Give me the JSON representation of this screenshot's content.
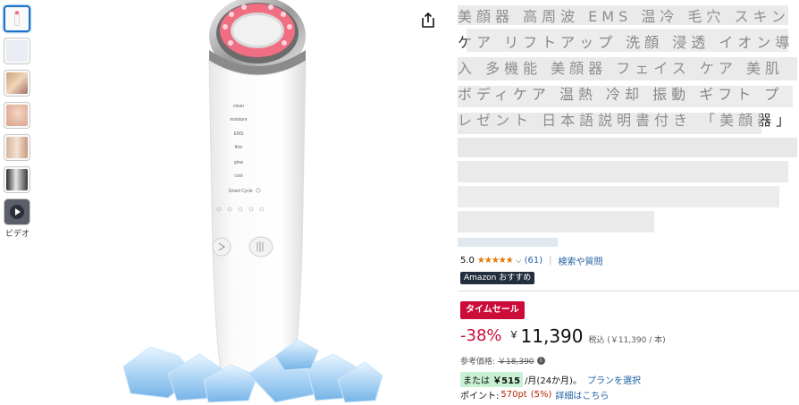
{
  "thumbnails": [
    {
      "name": "thumb-1",
      "active": true,
      "color": "#f2f2f2"
    },
    {
      "name": "thumb-2",
      "active": false,
      "color": "#e9edf3"
    },
    {
      "name": "thumb-3",
      "active": false,
      "color": "#c9a27b"
    },
    {
      "name": "thumb-4",
      "active": false,
      "color": "#e8c7b4"
    },
    {
      "name": "thumb-5",
      "active": false,
      "color": "#d7b59a"
    },
    {
      "name": "thumb-6",
      "active": false,
      "color": "#3b3b3b"
    }
  ],
  "video_label": "ビデオ",
  "device": {
    "labels": [
      "clean",
      "moisture",
      "EMS",
      "firm",
      "glow",
      "cool",
      "Smart Cycle"
    ],
    "accent": "#f06e82"
  },
  "title": {
    "text": "美顔器 高周波 EMS 温冷 毛穴 スキンケア リフトアップ 洗顔 浸透 イオン導入 多機能 美顔器 フェイス ケア 美肌 ボディケア 温熱 冷却 振動 ギフト プレゼント 日本語説明書付き 「美顔器」"
  },
  "rating": {
    "value": "5.0",
    "stars": "★★★★★",
    "count": "(61)",
    "qa": "検索や質問"
  },
  "amazon_badge": "Amazon おすすめ",
  "deal_label": "タイムセール",
  "price": {
    "discount": "-38%",
    "currency": "￥",
    "amount": "11,390",
    "tax_note": "税込 (￥11,390 / 本)"
  },
  "reference": {
    "label": "参考価格:",
    "value": "￥18,390"
  },
  "installment": {
    "prefix": "または",
    "amount": "￥515",
    "suffix": "/月(24か月)。",
    "link": "プランを選択"
  },
  "points": {
    "label": "ポイント:",
    "value": "570pt",
    "pct": "(5%)",
    "link": "詳細はこちら"
  },
  "colors": {
    "link": "#2162a1",
    "deal": "#cc0c39",
    "star": "#e07800"
  }
}
